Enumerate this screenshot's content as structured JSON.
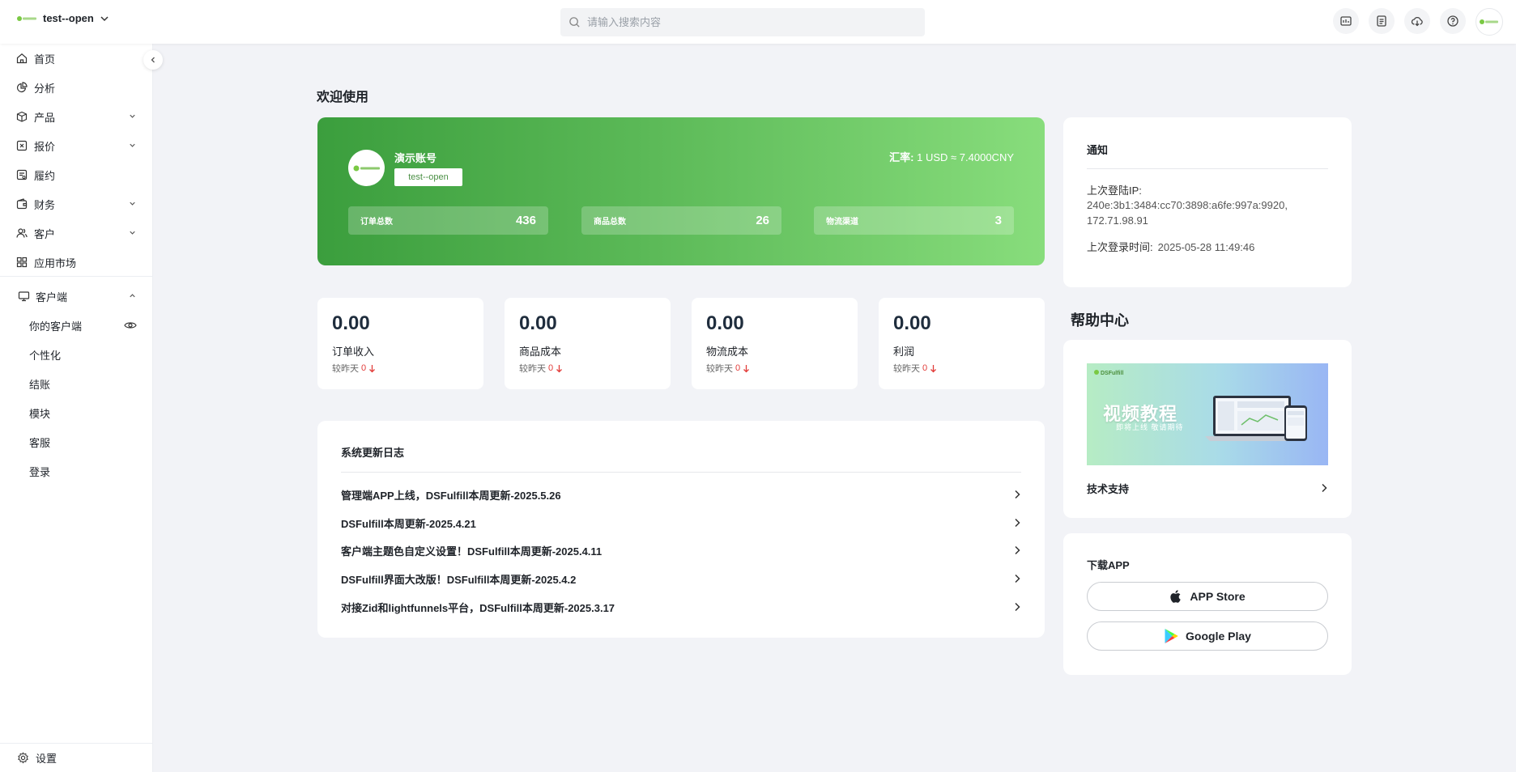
{
  "topbar": {
    "org_name": "test--open",
    "search_placeholder": "请输入搜索内容",
    "brand_logo_text": "DSFulfill"
  },
  "sidebar": {
    "items": [
      {
        "label": "首页",
        "icon": "home-icon"
      },
      {
        "label": "分析",
        "icon": "pie-chart-icon"
      },
      {
        "label": "产品",
        "icon": "box-icon",
        "expandable": true
      },
      {
        "label": "报价",
        "icon": "quote-icon",
        "expandable": true
      },
      {
        "label": "履约",
        "icon": "fulfillment-icon"
      },
      {
        "label": "财务",
        "icon": "wallet-icon",
        "expandable": true
      },
      {
        "label": "客户",
        "icon": "users-icon",
        "expandable": true
      },
      {
        "label": "应用市场",
        "icon": "apps-grid-icon"
      }
    ],
    "client_section": {
      "label": "客户端",
      "icon": "monitor-icon",
      "expanded": true,
      "sub_items": [
        "你的客户端",
        "个性化",
        "结账",
        "模块",
        "客服",
        "登录"
      ]
    },
    "settings_label": "设置"
  },
  "main": {
    "welcome": "欢迎使用",
    "hero": {
      "account_name": "演示账号",
      "account_tag": "test--open",
      "rate_label": "汇率:",
      "rate_value": "1 USD ≈ 7.4000CNY",
      "stats": [
        {
          "label": "订单总数",
          "value": "436"
        },
        {
          "label": "商品总数",
          "value": "26"
        },
        {
          "label": "物流渠道",
          "value": "3"
        }
      ],
      "gradient_colors": [
        "#3b9e3d",
        "#88dd7c"
      ]
    },
    "kpis": [
      {
        "value": "0.00",
        "label": "订单收入",
        "compare_label": "较昨天",
        "compare_value": "0"
      },
      {
        "value": "0.00",
        "label": "商品成本",
        "compare_label": "较昨天",
        "compare_value": "0"
      },
      {
        "value": "0.00",
        "label": "物流成本",
        "compare_label": "较昨天",
        "compare_value": "0"
      },
      {
        "value": "0.00",
        "label": "利润",
        "compare_label": "较昨天",
        "compare_value": "0"
      }
    ],
    "changelog": {
      "title": "系统更新日志",
      "items": [
        "管理端APP上线，DSFulfill本周更新-2025.5.26",
        "DSFulfill本周更新-2025.4.21",
        "客户端主题色自定义设置！DSFulfill本周更新-2025.4.11",
        "DSFulfill界面大改版！DSFulfill本周更新-2025.4.2",
        "对接Zid和lightfunnels平台，DSFulfill本周更新-2025.3.17"
      ]
    }
  },
  "right": {
    "notice": {
      "title": "通知",
      "ip_label": "上次登陆IP:",
      "ip_value": "240e:3b1:3484:cc70:3898:a6fe:997a:9920, 172.71.98.91",
      "time_label": "上次登录时间:",
      "time_value": "2025-05-28 11:49:46"
    },
    "help": {
      "title": "帮助中心",
      "banner_title": "视频教程",
      "banner_subtitle": "即将上线 敬请期待",
      "banner_logo": "DSFulfill",
      "tech_support": "技术支持"
    },
    "app": {
      "title": "下载APP",
      "app_store": "APP Store",
      "google_play": "Google Play"
    }
  },
  "colors": {
    "brand_green": "#4cae4c",
    "down_red": "#e23c39",
    "page_bg": "#f2f3f7"
  }
}
